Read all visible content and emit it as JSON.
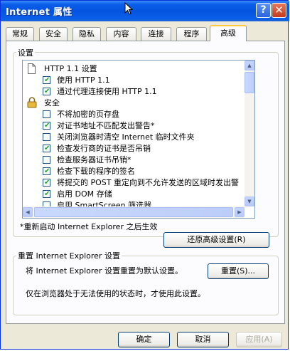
{
  "window": {
    "title": "Internet 属性"
  },
  "title_buttons": {
    "help": "?",
    "close": "✕"
  },
  "tabs": [
    {
      "label": "常规"
    },
    {
      "label": "安全"
    },
    {
      "label": "隐私"
    },
    {
      "label": "内容"
    },
    {
      "label": "连接"
    },
    {
      "label": "程序"
    },
    {
      "label": "高级"
    }
  ],
  "settings": {
    "group_label": "设置",
    "items": [
      {
        "label": "HTTP 1.1 设置",
        "kind": "header",
        "icon": "document-icon"
      },
      {
        "label": "使用 HTTP 1.1",
        "kind": "checkbox",
        "checked": true
      },
      {
        "label": "通过代理连接使用 HTTP 1.1",
        "kind": "checkbox",
        "checked": true
      },
      {
        "label": "安全",
        "kind": "header",
        "icon": "lock-icon"
      },
      {
        "label": "不将加密的页存盘",
        "kind": "checkbox",
        "checked": false
      },
      {
        "label": "对证书地址不匹配发出警告*",
        "kind": "checkbox",
        "checked": true
      },
      {
        "label": "关闭浏览器时清空 Internet 临时文件夹",
        "kind": "checkbox",
        "checked": false
      },
      {
        "label": "检查发行商的证书是否吊销",
        "kind": "checkbox",
        "checked": true
      },
      {
        "label": "检查服务器证书吊销*",
        "kind": "checkbox",
        "checked": false
      },
      {
        "label": "检查下载的程序的签名",
        "kind": "checkbox",
        "checked": true
      },
      {
        "label": "将提交的 POST 重定向到不允许发送的区域时发出警",
        "kind": "checkbox",
        "checked": true
      },
      {
        "label": "启用 DOM 存储",
        "kind": "checkbox",
        "checked": true
      },
      {
        "label": "启用 SmartScreen 筛选器",
        "kind": "checkbox",
        "checked": false
      }
    ],
    "note": "*重新启动 Internet Explorer 之后生效",
    "restore_button": "还原高级设置(R)"
  },
  "reset": {
    "group_label": "重置 Internet Explorer 设置",
    "description": "将 Internet Explorer 设置重置为默认设置。",
    "button": "重置(S)...",
    "hint": "仅在浏览器处于无法使用的状态时，才使用此设置。"
  },
  "footer": {
    "ok": "确定",
    "cancel": "取消",
    "apply": "应用(A)"
  },
  "colors": {
    "titlebar": "#0554e0",
    "window_border": "#0831d9",
    "dialog_bg": "#ece9d8",
    "tab_highlight": "#ffc83c",
    "check": "#21a121"
  }
}
